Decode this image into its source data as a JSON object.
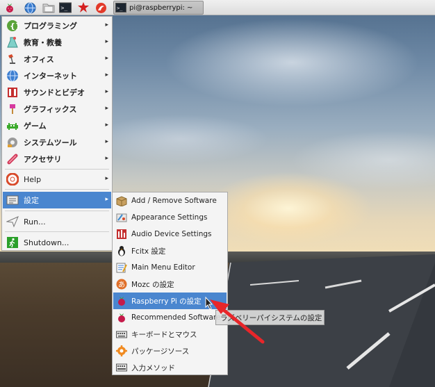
{
  "panel": {
    "task_title": "pi@raspberrypi: ~",
    "launchers": [
      "raspberry-menu-icon",
      "web-browser-icon",
      "file-manager-icon",
      "terminal-icon",
      "math-icon",
      "wolfram-icon"
    ]
  },
  "main_menu": {
    "items": [
      {
        "label": "プログラミング",
        "icon": "programming-icon"
      },
      {
        "label": "教育・教養",
        "icon": "education-icon"
      },
      {
        "label": "オフィス",
        "icon": "office-icon"
      },
      {
        "label": "インターネット",
        "icon": "internet-icon"
      },
      {
        "label": "サウンドとビデオ",
        "icon": "sound-video-icon"
      },
      {
        "label": "グラフィックス",
        "icon": "graphics-icon"
      },
      {
        "label": "ゲーム",
        "icon": "games-icon"
      },
      {
        "label": "システムツール",
        "icon": "system-tools-icon"
      },
      {
        "label": "アクセサリ",
        "icon": "accessories-icon"
      },
      {
        "label": "Help",
        "icon": "help-icon"
      },
      {
        "label": "設定",
        "icon": "preferences-icon"
      },
      {
        "label": "Run...",
        "icon": "run-icon"
      },
      {
        "label": "Shutdown...",
        "icon": "shutdown-icon"
      }
    ]
  },
  "sub_menu": {
    "items": [
      {
        "label": "Add / Remove Software",
        "icon": "package-icon"
      },
      {
        "label": "Appearance Settings",
        "icon": "appearance-icon"
      },
      {
        "label": "Audio Device Settings",
        "icon": "audio-icon"
      },
      {
        "label": "Fcitx 設定",
        "icon": "fcitx-icon"
      },
      {
        "label": "Main Menu Editor",
        "icon": "menu-editor-icon"
      },
      {
        "label": "Mozc の設定",
        "icon": "mozc-icon"
      },
      {
        "label": "Raspberry Pi の設定",
        "icon": "raspberry-icon"
      },
      {
        "label": "Recommended Software",
        "icon": "raspberry-icon"
      },
      {
        "label": "キーボードとマウス",
        "icon": "keyboard-icon"
      },
      {
        "label": "パッケージソース",
        "icon": "package-source-icon"
      },
      {
        "label": "入力メソッド",
        "icon": "input-method-icon"
      }
    ]
  },
  "tooltip": {
    "text": "ラズベリーパイシステムの設定"
  },
  "colors": {
    "highlight": "#4a86cf",
    "annotation_arrow": "#e8262a"
  }
}
